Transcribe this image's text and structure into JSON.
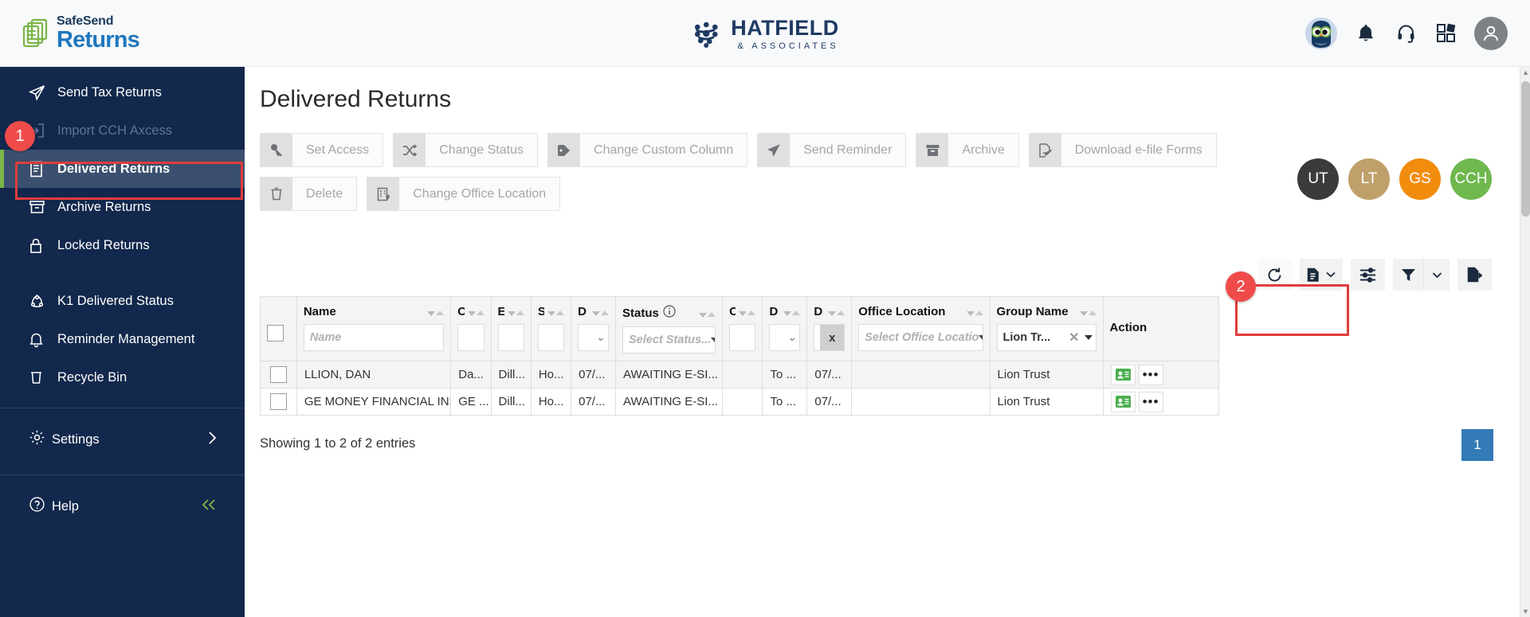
{
  "header": {
    "logo": {
      "top": "SafeSend",
      "bottom": "Returns",
      "icon": "document-stack-icon"
    },
    "brand": {
      "name": "HATFIELD",
      "sub": "& ASSOCIATES",
      "icon": "network-nodes-icon"
    },
    "icons": [
      {
        "name": "owl-avatar-icon",
        "label": "Owl"
      },
      {
        "name": "bell-icon",
        "label": "Notifications"
      },
      {
        "name": "headset-icon",
        "label": "Support"
      },
      {
        "name": "apps-grid-icon",
        "label": "Apps"
      },
      {
        "name": "user-avatar-icon",
        "label": "Account"
      }
    ]
  },
  "sidebar": {
    "items": [
      {
        "label": "Send Tax Returns",
        "icon": "paper-plane-icon",
        "state": "normal"
      },
      {
        "label": "Import CCH Axcess",
        "icon": "import-arrow-icon",
        "state": "disabled"
      },
      {
        "label": "Delivered Returns",
        "icon": "document-lines-icon",
        "state": "active"
      },
      {
        "label": "Archive Returns",
        "icon": "archive-box-icon",
        "state": "normal"
      },
      {
        "label": "Locked Returns",
        "icon": "lock-icon",
        "state": "normal"
      }
    ],
    "items2": [
      {
        "label": "K1 Delivered Status",
        "icon": "k1-share-icon",
        "state": "normal"
      },
      {
        "label": "Reminder Management",
        "icon": "bell-icon",
        "state": "normal"
      },
      {
        "label": "Recycle Bin",
        "icon": "trash-icon",
        "state": "normal"
      }
    ],
    "settings": {
      "label": "Settings",
      "icon": "gear-icon",
      "chevron": "chevron-right-icon"
    },
    "help": {
      "label": "Help",
      "icon": "question-circle-icon",
      "collapse": "double-chevron-left-icon"
    }
  },
  "main": {
    "title": "Delivered Returns",
    "toolbar": [
      {
        "label": "Set Access",
        "icon": "key-icon"
      },
      {
        "label": "Change Status",
        "icon": "shuffle-icon"
      },
      {
        "label": "Change Custom Column",
        "icon": "tag-icon"
      },
      {
        "label": "Send Reminder",
        "icon": "paper-plane-icon"
      },
      {
        "label": "Archive",
        "icon": "archive-box-icon"
      },
      {
        "label": "Download e-file Forms",
        "icon": "download-signature-icon"
      },
      {
        "label": "Delete",
        "icon": "trash-icon"
      },
      {
        "label": "Change Office Location",
        "icon": "office-location-icon"
      }
    ],
    "avatars": [
      {
        "initials": "UT",
        "color": "#3b3b3b"
      },
      {
        "initials": "LT",
        "color": "#c0a06a"
      },
      {
        "initials": "GS",
        "color": "#f28c0f"
      },
      {
        "initials": "CCH",
        "color": "#6fb84e"
      }
    ],
    "grid_actions": [
      {
        "name": "refresh-icon"
      },
      {
        "name": "report-dropdown-icon"
      },
      {
        "name": "column-settings-icon"
      },
      {
        "name": "filter-dropdown-icon"
      },
      {
        "name": "export-icon"
      }
    ],
    "columns": [
      {
        "key": "check",
        "label": "",
        "filter_type": "none"
      },
      {
        "key": "name",
        "label": "Name",
        "filter_type": "text",
        "placeholder": "Name"
      },
      {
        "key": "c1",
        "label": "C",
        "filter_type": "text",
        "placeholder": ""
      },
      {
        "key": "e1",
        "label": "E",
        "filter_type": "text",
        "placeholder": ""
      },
      {
        "key": "s1",
        "label": "S",
        "filter_type": "text",
        "placeholder": ""
      },
      {
        "key": "d1",
        "label": "D",
        "filter_type": "chevron",
        "placeholder": ""
      },
      {
        "key": "status",
        "label": "Status",
        "filter_type": "select",
        "placeholder": "Select Status...",
        "info": true
      },
      {
        "key": "c2",
        "label": "C",
        "filter_type": "text",
        "placeholder": ""
      },
      {
        "key": "d2",
        "label": "D",
        "filter_type": "chevron",
        "placeholder": ""
      },
      {
        "key": "d3",
        "label": "D",
        "filter_type": "clear",
        "placeholder": "x"
      },
      {
        "key": "office",
        "label": "Office Location",
        "filter_type": "select",
        "placeholder": "Select Office Locatio"
      },
      {
        "key": "group",
        "label": "Group Name",
        "filter_type": "chip",
        "value": "Lion Tr..."
      },
      {
        "key": "action",
        "label": "Action",
        "filter_type": "none"
      }
    ],
    "rows": [
      {
        "name": "LLION, DAN",
        "c1": "Da...",
        "e1": "Dill...",
        "s1": "Ho...",
        "d1": "07/...",
        "status": "AWAITING E-SI...",
        "c2": "",
        "d2": "To ...",
        "d3": "07/...",
        "office": "",
        "group": "Lion Trust",
        "actions": [
          "contact-card-icon",
          "ellipsis-icon"
        ]
      },
      {
        "name": "GE MONEY FINANCIAL INSTI...",
        "c1": "GE ...",
        "e1": "Dill...",
        "s1": "Ho...",
        "d1": "07/...",
        "status": "AWAITING E-SI...",
        "c2": "",
        "d2": "To ...",
        "d3": "07/...",
        "office": "",
        "group": "Lion Trust",
        "actions": [
          "contact-card-icon",
          "ellipsis-icon"
        ]
      }
    ],
    "showing": "Showing 1 to 2 of 2 entries",
    "pagination": {
      "current": "1"
    }
  },
  "annotations": [
    {
      "badge": "1",
      "target": "sidebar-item-delivered-returns"
    },
    {
      "badge": "2",
      "target": "group-name-column-filter"
    }
  ],
  "colors": {
    "sidebar_bg": "#12284c",
    "sidebar_active": "#3b4f6e",
    "accent_green": "#7ab648",
    "brand_blue": "#1f77bd",
    "pager_blue": "#337ab7",
    "annotation_red": "#e03c3c"
  }
}
